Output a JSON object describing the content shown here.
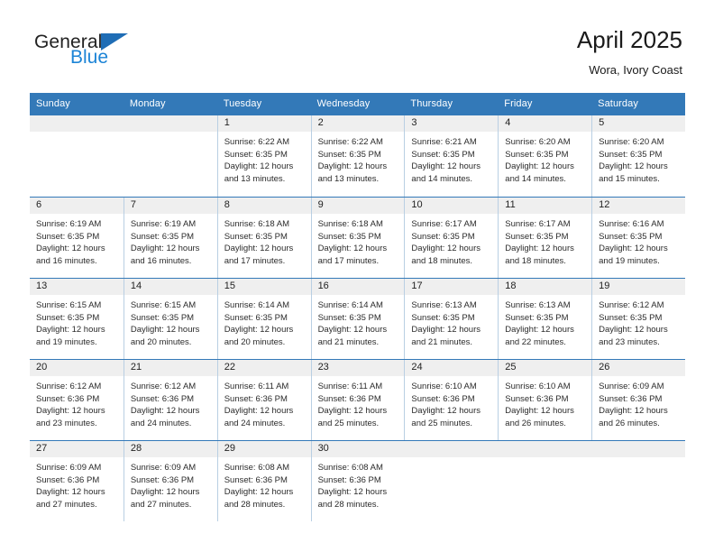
{
  "brand": {
    "line1": "General",
    "line2": "Blue",
    "flag_icon": "blue-triangle-flag-icon",
    "accent_color": "#1c84d6"
  },
  "header": {
    "title": "April 2025",
    "subtitle": "Wora, Ivory Coast"
  },
  "theme": {
    "header_blue": "#3379b8",
    "band_gray": "#efefef",
    "cell_border": "#b9cfe3"
  },
  "weekdays": [
    "Sunday",
    "Monday",
    "Tuesday",
    "Wednesday",
    "Thursday",
    "Friday",
    "Saturday"
  ],
  "weeks": [
    [
      {
        "day": "",
        "sunrise": "",
        "sunset": "",
        "daylight1": "",
        "daylight2": ""
      },
      {
        "day": "",
        "sunrise": "",
        "sunset": "",
        "daylight1": "",
        "daylight2": ""
      },
      {
        "day": "1",
        "sunrise": "Sunrise: 6:22 AM",
        "sunset": "Sunset: 6:35 PM",
        "daylight1": "Daylight: 12 hours",
        "daylight2": "and 13 minutes."
      },
      {
        "day": "2",
        "sunrise": "Sunrise: 6:22 AM",
        "sunset": "Sunset: 6:35 PM",
        "daylight1": "Daylight: 12 hours",
        "daylight2": "and 13 minutes."
      },
      {
        "day": "3",
        "sunrise": "Sunrise: 6:21 AM",
        "sunset": "Sunset: 6:35 PM",
        "daylight1": "Daylight: 12 hours",
        "daylight2": "and 14 minutes."
      },
      {
        "day": "4",
        "sunrise": "Sunrise: 6:20 AM",
        "sunset": "Sunset: 6:35 PM",
        "daylight1": "Daylight: 12 hours",
        "daylight2": "and 14 minutes."
      },
      {
        "day": "5",
        "sunrise": "Sunrise: 6:20 AM",
        "sunset": "Sunset: 6:35 PM",
        "daylight1": "Daylight: 12 hours",
        "daylight2": "and 15 minutes."
      }
    ],
    [
      {
        "day": "6",
        "sunrise": "Sunrise: 6:19 AM",
        "sunset": "Sunset: 6:35 PM",
        "daylight1": "Daylight: 12 hours",
        "daylight2": "and 16 minutes."
      },
      {
        "day": "7",
        "sunrise": "Sunrise: 6:19 AM",
        "sunset": "Sunset: 6:35 PM",
        "daylight1": "Daylight: 12 hours",
        "daylight2": "and 16 minutes."
      },
      {
        "day": "8",
        "sunrise": "Sunrise: 6:18 AM",
        "sunset": "Sunset: 6:35 PM",
        "daylight1": "Daylight: 12 hours",
        "daylight2": "and 17 minutes."
      },
      {
        "day": "9",
        "sunrise": "Sunrise: 6:18 AM",
        "sunset": "Sunset: 6:35 PM",
        "daylight1": "Daylight: 12 hours",
        "daylight2": "and 17 minutes."
      },
      {
        "day": "10",
        "sunrise": "Sunrise: 6:17 AM",
        "sunset": "Sunset: 6:35 PM",
        "daylight1": "Daylight: 12 hours",
        "daylight2": "and 18 minutes."
      },
      {
        "day": "11",
        "sunrise": "Sunrise: 6:17 AM",
        "sunset": "Sunset: 6:35 PM",
        "daylight1": "Daylight: 12 hours",
        "daylight2": "and 18 minutes."
      },
      {
        "day": "12",
        "sunrise": "Sunrise: 6:16 AM",
        "sunset": "Sunset: 6:35 PM",
        "daylight1": "Daylight: 12 hours",
        "daylight2": "and 19 minutes."
      }
    ],
    [
      {
        "day": "13",
        "sunrise": "Sunrise: 6:15 AM",
        "sunset": "Sunset: 6:35 PM",
        "daylight1": "Daylight: 12 hours",
        "daylight2": "and 19 minutes."
      },
      {
        "day": "14",
        "sunrise": "Sunrise: 6:15 AM",
        "sunset": "Sunset: 6:35 PM",
        "daylight1": "Daylight: 12 hours",
        "daylight2": "and 20 minutes."
      },
      {
        "day": "15",
        "sunrise": "Sunrise: 6:14 AM",
        "sunset": "Sunset: 6:35 PM",
        "daylight1": "Daylight: 12 hours",
        "daylight2": "and 20 minutes."
      },
      {
        "day": "16",
        "sunrise": "Sunrise: 6:14 AM",
        "sunset": "Sunset: 6:35 PM",
        "daylight1": "Daylight: 12 hours",
        "daylight2": "and 21 minutes."
      },
      {
        "day": "17",
        "sunrise": "Sunrise: 6:13 AM",
        "sunset": "Sunset: 6:35 PM",
        "daylight1": "Daylight: 12 hours",
        "daylight2": "and 21 minutes."
      },
      {
        "day": "18",
        "sunrise": "Sunrise: 6:13 AM",
        "sunset": "Sunset: 6:35 PM",
        "daylight1": "Daylight: 12 hours",
        "daylight2": "and 22 minutes."
      },
      {
        "day": "19",
        "sunrise": "Sunrise: 6:12 AM",
        "sunset": "Sunset: 6:35 PM",
        "daylight1": "Daylight: 12 hours",
        "daylight2": "and 23 minutes."
      }
    ],
    [
      {
        "day": "20",
        "sunrise": "Sunrise: 6:12 AM",
        "sunset": "Sunset: 6:36 PM",
        "daylight1": "Daylight: 12 hours",
        "daylight2": "and 23 minutes."
      },
      {
        "day": "21",
        "sunrise": "Sunrise: 6:12 AM",
        "sunset": "Sunset: 6:36 PM",
        "daylight1": "Daylight: 12 hours",
        "daylight2": "and 24 minutes."
      },
      {
        "day": "22",
        "sunrise": "Sunrise: 6:11 AM",
        "sunset": "Sunset: 6:36 PM",
        "daylight1": "Daylight: 12 hours",
        "daylight2": "and 24 minutes."
      },
      {
        "day": "23",
        "sunrise": "Sunrise: 6:11 AM",
        "sunset": "Sunset: 6:36 PM",
        "daylight1": "Daylight: 12 hours",
        "daylight2": "and 25 minutes."
      },
      {
        "day": "24",
        "sunrise": "Sunrise: 6:10 AM",
        "sunset": "Sunset: 6:36 PM",
        "daylight1": "Daylight: 12 hours",
        "daylight2": "and 25 minutes."
      },
      {
        "day": "25",
        "sunrise": "Sunrise: 6:10 AM",
        "sunset": "Sunset: 6:36 PM",
        "daylight1": "Daylight: 12 hours",
        "daylight2": "and 26 minutes."
      },
      {
        "day": "26",
        "sunrise": "Sunrise: 6:09 AM",
        "sunset": "Sunset: 6:36 PM",
        "daylight1": "Daylight: 12 hours",
        "daylight2": "and 26 minutes."
      }
    ],
    [
      {
        "day": "27",
        "sunrise": "Sunrise: 6:09 AM",
        "sunset": "Sunset: 6:36 PM",
        "daylight1": "Daylight: 12 hours",
        "daylight2": "and 27 minutes."
      },
      {
        "day": "28",
        "sunrise": "Sunrise: 6:09 AM",
        "sunset": "Sunset: 6:36 PM",
        "daylight1": "Daylight: 12 hours",
        "daylight2": "and 27 minutes."
      },
      {
        "day": "29",
        "sunrise": "Sunrise: 6:08 AM",
        "sunset": "Sunset: 6:36 PM",
        "daylight1": "Daylight: 12 hours",
        "daylight2": "and 28 minutes."
      },
      {
        "day": "30",
        "sunrise": "Sunrise: 6:08 AM",
        "sunset": "Sunset: 6:36 PM",
        "daylight1": "Daylight: 12 hours",
        "daylight2": "and 28 minutes."
      },
      {
        "day": "",
        "sunrise": "",
        "sunset": "",
        "daylight1": "",
        "daylight2": ""
      },
      {
        "day": "",
        "sunrise": "",
        "sunset": "",
        "daylight1": "",
        "daylight2": ""
      },
      {
        "day": "",
        "sunrise": "",
        "sunset": "",
        "daylight1": "",
        "daylight2": ""
      }
    ]
  ]
}
